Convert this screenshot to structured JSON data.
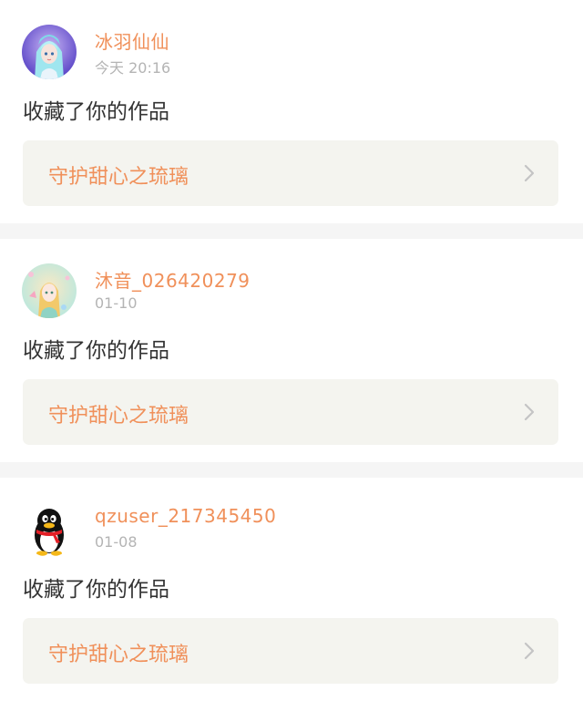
{
  "notifications": [
    {
      "username": "冰羽仙仙",
      "time": "今天 20:16",
      "action": "收藏了你的作品",
      "work_title": "守护甜心之琉璃",
      "avatar": "anime-girl-avatar-blue"
    },
    {
      "username": "沐音_026420279",
      "time": "01-10",
      "action": "收藏了你的作品",
      "work_title": "守护甜心之琉璃",
      "avatar": "anime-girl-avatar-pastel"
    },
    {
      "username": "qzuser_217345450",
      "time": "01-08",
      "action": "收藏了你的作品",
      "work_title": "守护甜心之琉璃",
      "avatar": "qq-penguin-avatar"
    }
  ],
  "colors": {
    "accent": "#f0905a",
    "timestamp": "#b4b4b4",
    "body_text": "#333333",
    "card_bg": "#f4f4ef",
    "separator": "#f5f5f5",
    "chevron": "#c4c4c4"
  }
}
